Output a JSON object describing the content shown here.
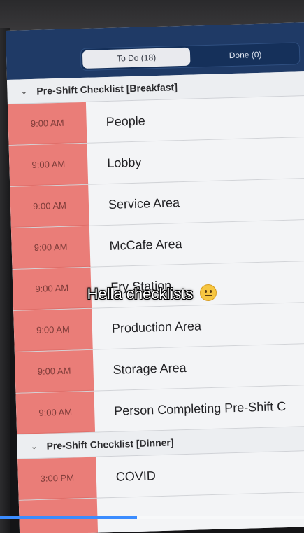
{
  "tabs": [
    {
      "label": "To Do (18)",
      "active": true
    },
    {
      "label": "Done (0)",
      "active": false
    }
  ],
  "sections": [
    {
      "title": "Pre-Shift Checklist [Breakfast]",
      "rows": [
        {
          "time": "9:00 AM",
          "label": "People"
        },
        {
          "time": "9:00 AM",
          "label": "Lobby"
        },
        {
          "time": "9:00 AM",
          "label": "Service Area"
        },
        {
          "time": "9:00 AM",
          "label": "McCafe Area"
        },
        {
          "time": "9:00 AM",
          "label": "Fry Station"
        },
        {
          "time": "9:00 AM",
          "label": "Production Area"
        },
        {
          "time": "9:00 AM",
          "label": "Storage Area"
        },
        {
          "time": "9:00 AM",
          "label": "Person Completing Pre-Shift C"
        }
      ]
    },
    {
      "title": "Pre-Shift Checklist [Dinner]",
      "rows": [
        {
          "time": "3:00 PM",
          "label": "COVID"
        }
      ]
    }
  ],
  "overlay": {
    "caption": "Hella checklists",
    "emoji": "neutral-face-icon"
  },
  "video_progress": 0.45,
  "colors": {
    "time_cell": "#ea7d78",
    "accent": "#3b8cff"
  }
}
